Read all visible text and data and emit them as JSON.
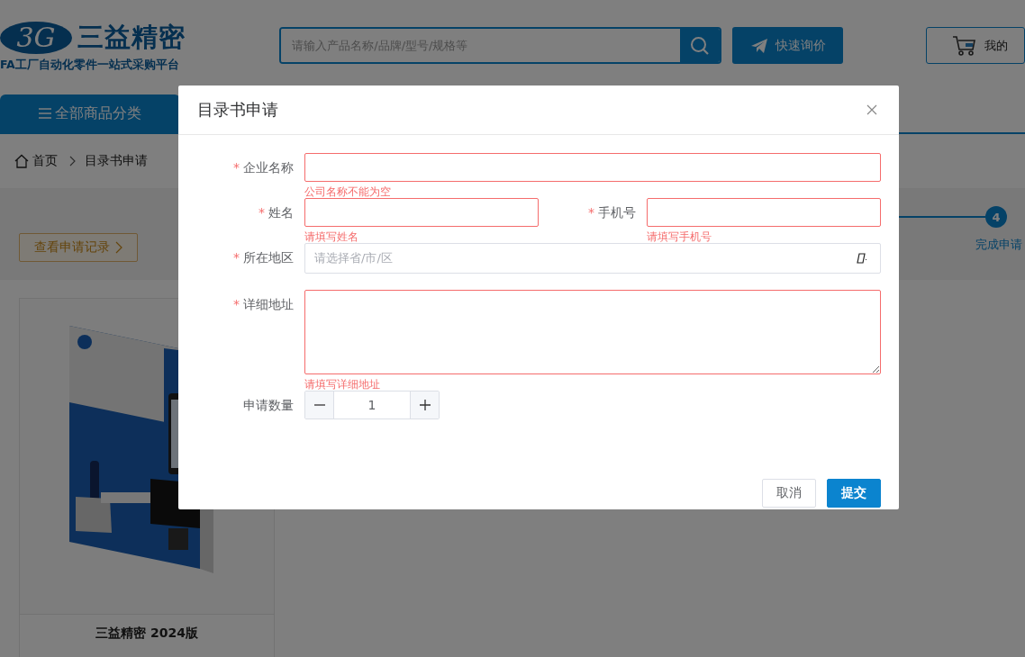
{
  "header": {
    "logo": {
      "mark": "3G",
      "name": "三益精密",
      "tagline": "FA工厂自动化零件一站式采购平台"
    },
    "search": {
      "placeholder": "请输入产品名称/品牌/型号/规格等"
    },
    "quote_button": "快速询价",
    "cart_button": "我的"
  },
  "nav": {
    "category_tab": "全部商品分类"
  },
  "breadcrumb": [
    {
      "label": "首页"
    },
    {
      "label": "目录书申请"
    }
  ],
  "records_button": "查看申请记录",
  "steps": [
    {
      "number": "4",
      "label": "完成申请"
    }
  ],
  "catalog": {
    "kind": "picture",
    "title": "三益精密 2024版"
  },
  "dialog": {
    "title": "目录书申请",
    "required_mark": "*",
    "rows": [
      {
        "fields": [
          {
            "kind": "text",
            "label": "企业名称",
            "required": true,
            "error": "公司名称不能为空"
          }
        ]
      },
      {
        "fields": [
          {
            "kind": "text",
            "label": "姓名",
            "required": true,
            "error": "请填写姓名"
          },
          {
            "kind": "text",
            "label": "手机号",
            "required": true,
            "error": "请填写手机号"
          }
        ]
      },
      {
        "fields": [
          {
            "kind": "select",
            "label": "所在地区",
            "required": true,
            "placeholder": "请选择省/市/区"
          }
        ]
      },
      {
        "fields": [
          {
            "kind": "textarea",
            "label": "详细地址",
            "required": true,
            "error": "请填写详细地址"
          }
        ]
      },
      {
        "fields": [
          {
            "kind": "stepper",
            "label": "申请数量",
            "required": false,
            "value": "1"
          }
        ]
      }
    ],
    "cancel_button": "取消",
    "submit_button": "提交"
  }
}
